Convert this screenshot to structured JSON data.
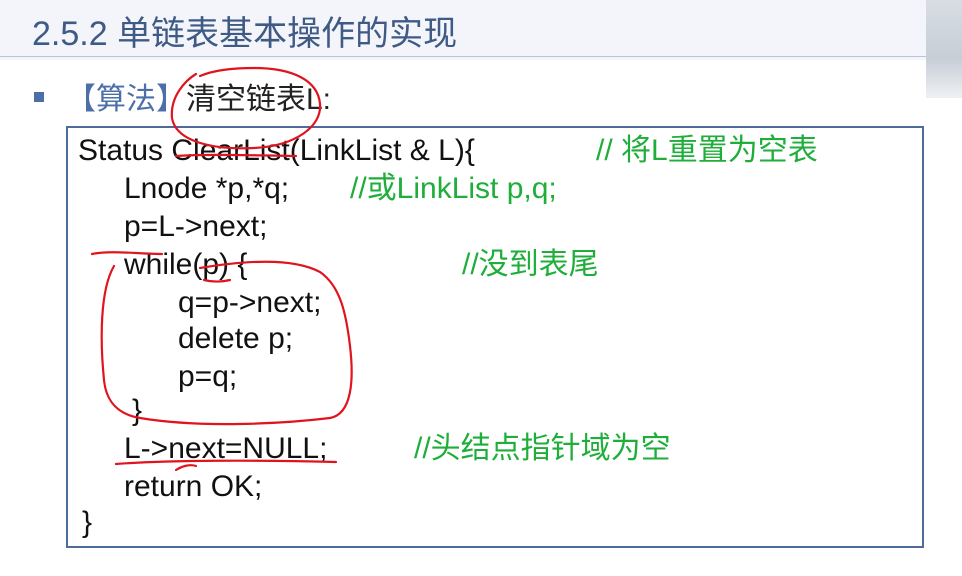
{
  "slide": {
    "title": "2.5.2 单链表基本操作的实现",
    "bullet": {
      "tag": "【算法】",
      "text": "清空链表L:"
    }
  },
  "code": {
    "lines": [
      {
        "code": "Status ClearList(LinkList & L){",
        "comment": "// 将L重置为空表"
      },
      {
        "code": "Lnode *p,*q;",
        "comment": "//或LinkList p,q;"
      },
      {
        "code": "p=L->next;",
        "comment": ""
      },
      {
        "code": "while(p) {",
        "comment": "//没到表尾"
      },
      {
        "code": "q=p->next;",
        "comment": ""
      },
      {
        "code": "delete p;",
        "comment": ""
      },
      {
        "code": "p=q;",
        "comment": ""
      },
      {
        "code": "}",
        "comment": ""
      },
      {
        "code": "L->next=NULL;",
        "comment": "//头结点指针域为空"
      },
      {
        "code": "return OK;",
        "comment": ""
      },
      {
        "code": "}",
        "comment": ""
      }
    ]
  },
  "colors": {
    "title": "#3e5a85",
    "accent": "#4d6fa8",
    "comment": "#1fae3a",
    "annotation": "#e0141e",
    "box_border": "#4f6b99"
  }
}
